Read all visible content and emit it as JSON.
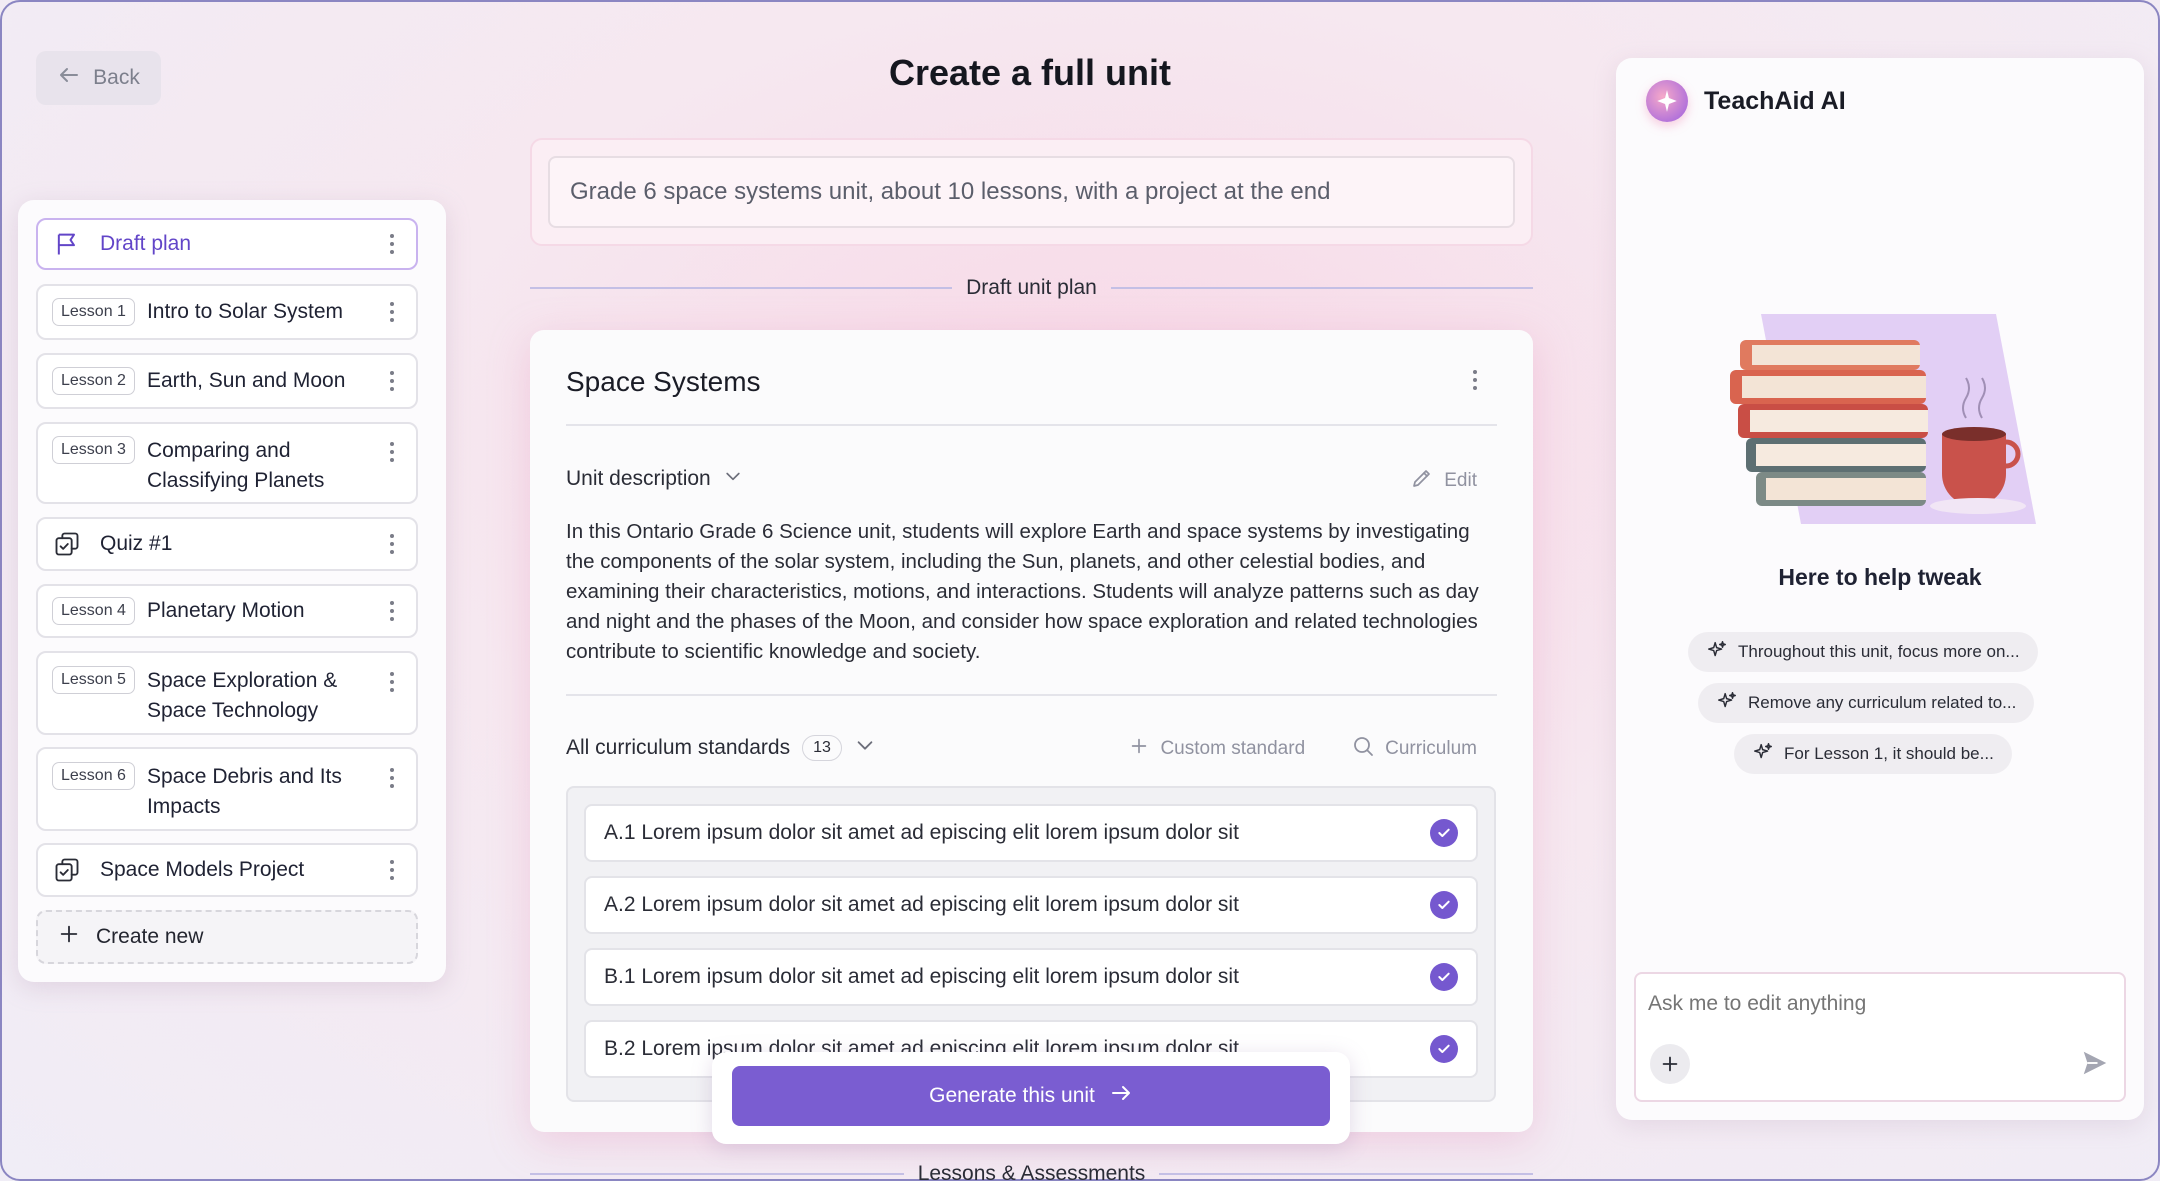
{
  "header": {
    "back_label": "Back",
    "title": "Create a full unit"
  },
  "sidebar": {
    "items": [
      {
        "type": "draft",
        "label": "Draft plan"
      },
      {
        "type": "lesson",
        "chip": "Lesson 1",
        "label": "Intro to Solar System"
      },
      {
        "type": "lesson",
        "chip": "Lesson 2",
        "label": "Earth, Sun and Moon"
      },
      {
        "type": "lesson",
        "chip": "Lesson 3",
        "label": "Comparing and Classifying Planets"
      },
      {
        "type": "quiz",
        "label": "Quiz #1"
      },
      {
        "type": "lesson",
        "chip": "Lesson 4",
        "label": "Planetary Motion"
      },
      {
        "type": "lesson",
        "chip": "Lesson 5",
        "label": "Space Exploration & Space Technology"
      },
      {
        "type": "lesson",
        "chip": "Lesson 6",
        "label": "Space Debris and Its Impacts"
      },
      {
        "type": "project",
        "label": "Space Models Project"
      }
    ],
    "create_new": "Create new"
  },
  "prompt": {
    "value": "Grade 6 space systems unit, about 10 lessons, with a project at the end"
  },
  "draft_divider": "Draft unit plan",
  "unit": {
    "title": "Space Systems",
    "description_label": "Unit description",
    "edit_label": "Edit",
    "description": "In this Ontario Grade 6 Science unit, students will explore Earth and space systems by investigating the components of the solar system, including the Sun, planets, and other celestial bodies, and examining their characteristics, motions, and interactions. Students will analyze patterns such as day and night and the phases of the Moon, and consider how space exploration and related technologies contribute to scientific knowledge and society.",
    "standards_label": "All curriculum standards",
    "standards_count": "13",
    "custom_standard": "Custom standard",
    "curriculum": "Curriculum",
    "standards": [
      {
        "text": "A.1 Lorem ipsum dolor sit amet ad episcing elit lorem ipsum dolor sit",
        "checked": true
      },
      {
        "text": "A.2 Lorem ipsum dolor sit amet ad episcing elit lorem ipsum dolor sit",
        "checked": true
      },
      {
        "text": "B.1 Lorem ipsum dolor sit amet ad episcing elit lorem ipsum dolor sit",
        "checked": true
      },
      {
        "text": "B.2 Lorem ipsum dolor sit amet ad episcing elit lorem ipsum dolor sit",
        "checked": true
      }
    ]
  },
  "generate_label": "Generate this unit",
  "lessons_divider": "Lessons & Assessments",
  "ai": {
    "title": "TeachAid AI",
    "help_title": "Here to help tweak",
    "suggestions": [
      "Throughout this unit, focus more on...",
      "Remove any curriculum related to...",
      "For Lesson 1, it should be..."
    ],
    "chat_placeholder": "Ask me to edit anything"
  },
  "colors": {
    "accent": "#7a5dd1",
    "active_border": "#c9b3ef",
    "background": "#f6e8f0"
  }
}
